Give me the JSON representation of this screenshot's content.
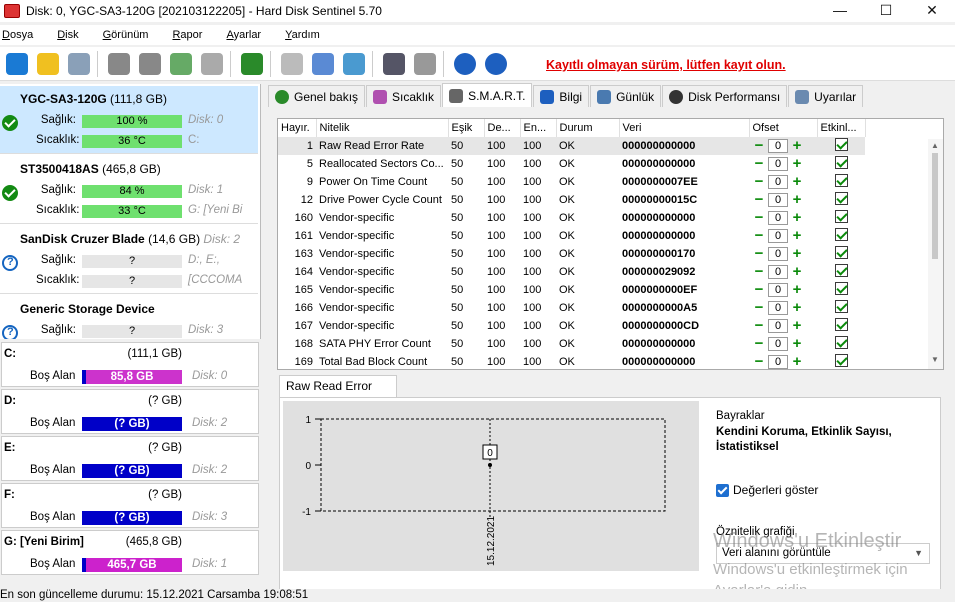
{
  "window": {
    "title": "Disk: 0, YGC-SA3-120G [202103122205]  -  Hard Disk Sentinel 5.70",
    "minimize": "—",
    "maximize": "☐",
    "close": "✕"
  },
  "menu": [
    "Dosya",
    "Disk",
    "Görünüm",
    "Rapor",
    "Ayarlar",
    "Yardım"
  ],
  "menu_underline": [
    "D",
    "D",
    "G",
    "R",
    "A",
    "Y"
  ],
  "toolbar": {
    "register_link": "Kayıtlı olmayan sürüm, lütfen kayıt olun.",
    "icons": [
      "refresh-icon",
      "warning-icon",
      "disk-icon",
      "hdd-tool-icon",
      "usb-disk-icon",
      "disk-ok-icon",
      "disk-wrench-icon",
      "globe-icon",
      "report-icon",
      "copy-icon",
      "network-icon",
      "monitor-icon",
      "speaker-icon",
      "help-icon",
      "info-icon"
    ]
  },
  "disks": [
    {
      "name": "YGC-SA3-120G",
      "size": "(111,8 GB)",
      "health_label": "Sağlık:",
      "health": "100 %",
      "temp_label": "Sıcaklık:",
      "temp": "36 °C",
      "disk_meta": "Disk: 0",
      "drive_meta": "C:",
      "status": "ok"
    },
    {
      "name": "ST3500418AS",
      "size": "(465,8 GB)",
      "health_label": "Sağlık:",
      "health": "84 %",
      "temp_label": "Sıcaklık:",
      "temp": "33 °C",
      "disk_meta": "Disk: 1",
      "drive_meta": "G: [Yeni Bi",
      "status": "ok"
    },
    {
      "name": "SanDisk Cruzer Blade",
      "size": "(14,6 GB)",
      "disk_inline": "Disk: 2",
      "health_label": "Sağlık:",
      "health": "?",
      "temp_label": "Sıcaklık:",
      "temp": "?",
      "disk_meta": "D:, E:,",
      "drive_meta": "[CCCOMA",
      "status": "unknown"
    },
    {
      "name": "Generic Storage Device",
      "size": "",
      "health_label": "Sağlık:",
      "health": "?",
      "disk_meta": "Disk: 3",
      "status": "unknown"
    }
  ],
  "partitions": [
    {
      "name": "C:",
      "size": "(111,1 GB)",
      "free_label": "Boş Alan",
      "free": "85,8 GB",
      "disk": "Disk: 0",
      "bar_color": "#cc33cc"
    },
    {
      "name": "D:",
      "size": "(? GB)",
      "free_label": "Boş Alan",
      "free": "(? GB)",
      "disk": "Disk: 2",
      "bar_color": "#0000c8"
    },
    {
      "name": "E:",
      "size": "(? GB)",
      "free_label": "Boş Alan",
      "free": "(? GB)",
      "disk": "Disk: 2",
      "bar_color": "#0000c8"
    },
    {
      "name": "F:",
      "size": "(? GB)",
      "free_label": "Boş Alan",
      "free": "(? GB)",
      "disk": "Disk: 3",
      "bar_color": "#0000c8"
    },
    {
      "name": "G: [Yeni Birim]",
      "size": "(465,8 GB)",
      "free_label": "Boş Alan",
      "free": "465,7 GB",
      "disk": "Disk: 1",
      "bar_color": "#cc22cc"
    }
  ],
  "tabs": [
    {
      "label": "Genel bakış",
      "icon": "overview-icon"
    },
    {
      "label": "Sıcaklık",
      "icon": "thermometer-icon"
    },
    {
      "label": "S.M.A.R.T.",
      "icon": "smart-icon",
      "active": true
    },
    {
      "label": "Bilgi",
      "icon": "info-icon"
    },
    {
      "label": "Günlük",
      "icon": "log-icon"
    },
    {
      "label": "Disk Performansı",
      "icon": "performance-icon"
    },
    {
      "label": "Uyarılar",
      "icon": "alerts-icon"
    }
  ],
  "smart": {
    "columns": [
      "Hayır.",
      "Nitelik",
      "Eşik",
      "De...",
      "En...",
      "Durum",
      "Veri",
      "Ofset",
      "Etkinl..."
    ],
    "rows": [
      {
        "no": "1",
        "name": "Raw Read Error Rate",
        "threshold": "50",
        "value": "100",
        "worst": "100",
        "status": "OK",
        "raw": "000000000000",
        "offset": "0"
      },
      {
        "no": "5",
        "name": "Reallocated Sectors Co...",
        "threshold": "50",
        "value": "100",
        "worst": "100",
        "status": "OK",
        "raw": "000000000000",
        "offset": "0"
      },
      {
        "no": "9",
        "name": "Power On Time Count",
        "threshold": "50",
        "value": "100",
        "worst": "100",
        "status": "OK",
        "raw": "0000000007EE",
        "offset": "0"
      },
      {
        "no": "12",
        "name": "Drive Power Cycle Count",
        "threshold": "50",
        "value": "100",
        "worst": "100",
        "status": "OK",
        "raw": "00000000015C",
        "offset": "0"
      },
      {
        "no": "160",
        "name": "Vendor-specific",
        "threshold": "50",
        "value": "100",
        "worst": "100",
        "status": "OK",
        "raw": "000000000000",
        "offset": "0"
      },
      {
        "no": "161",
        "name": "Vendor-specific",
        "threshold": "50",
        "value": "100",
        "worst": "100",
        "status": "OK",
        "raw": "000000000000",
        "offset": "0"
      },
      {
        "no": "163",
        "name": "Vendor-specific",
        "threshold": "50",
        "value": "100",
        "worst": "100",
        "status": "OK",
        "raw": "000000000170",
        "offset": "0"
      },
      {
        "no": "164",
        "name": "Vendor-specific",
        "threshold": "50",
        "value": "100",
        "worst": "100",
        "status": "OK",
        "raw": "000000029092",
        "offset": "0"
      },
      {
        "no": "165",
        "name": "Vendor-specific",
        "threshold": "50",
        "value": "100",
        "worst": "100",
        "status": "OK",
        "raw": "0000000000EF",
        "offset": "0"
      },
      {
        "no": "166",
        "name": "Vendor-specific",
        "threshold": "50",
        "value": "100",
        "worst": "100",
        "status": "OK",
        "raw": "0000000000A5",
        "offset": "0"
      },
      {
        "no": "167",
        "name": "Vendor-specific",
        "threshold": "50",
        "value": "100",
        "worst": "100",
        "status": "OK",
        "raw": "0000000000CD",
        "offset": "0"
      },
      {
        "no": "168",
        "name": "SATA PHY Error Count",
        "threshold": "50",
        "value": "100",
        "worst": "100",
        "status": "OK",
        "raw": "000000000000",
        "offset": "0"
      },
      {
        "no": "169",
        "name": "Total Bad Block Count",
        "threshold": "50",
        "value": "100",
        "worst": "100",
        "status": "OK",
        "raw": "000000000000",
        "offset": "0"
      }
    ]
  },
  "graph": {
    "tab_label": "Raw Read Error Rate",
    "chart_data": {
      "type": "line",
      "x": [
        "15.12.2021"
      ],
      "series": [
        {
          "values": [
            0
          ]
        }
      ],
      "data_labels": [
        "0"
      ],
      "ylim": [
        -1,
        1
      ],
      "yticks": [
        "1",
        "0",
        "-1"
      ]
    }
  },
  "side": {
    "flags_title": "Bayraklar",
    "flags": "Kendini Koruma, Etkinlik Sayısı, İstatistiksel",
    "show_values": "Değerleri göster",
    "attr_graph_label": "Öznitelik grafiği",
    "attr_graph_value": "Veri alanını görüntüle"
  },
  "watermark": {
    "line1": "Windows'u Etkinleştir",
    "line2": "Windows'u etkinleştirmek için",
    "line3": "Ayarlar'a gidin."
  },
  "status_bar": "En son güncelleme durumu: 15.12.2021 Carsamba 19:08:51"
}
